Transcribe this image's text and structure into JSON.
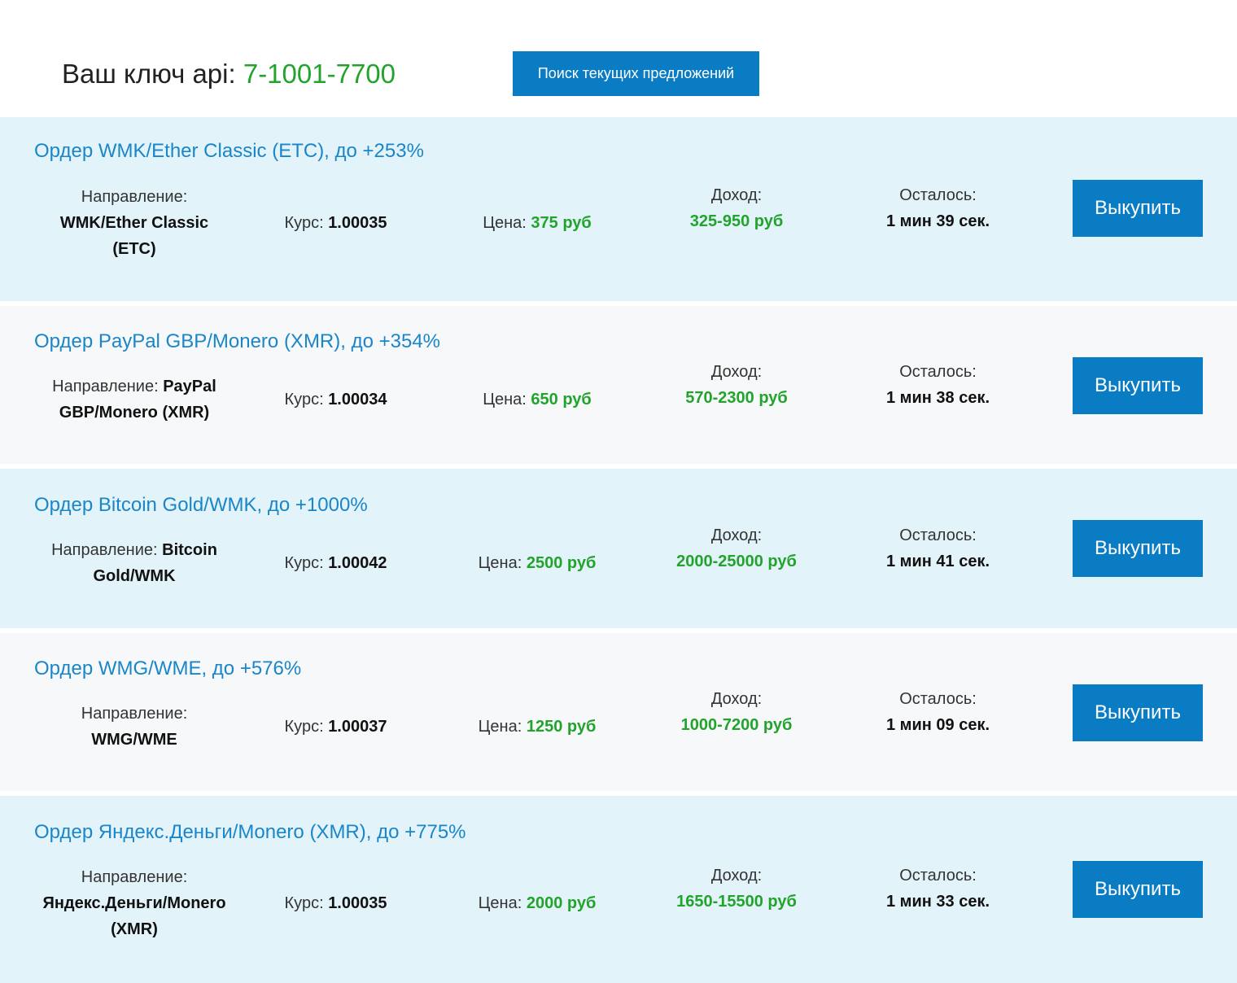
{
  "header": {
    "api_label": "Ваш ключ api:",
    "api_key": "7-1001-7700",
    "search_button": "Поиск текущих предложений"
  },
  "labels": {
    "direction": "Направление:",
    "rate": "Курс:",
    "price": "Цена:",
    "income": "Доход:",
    "remaining": "Осталось:",
    "buy": "Выкупить"
  },
  "orders": [
    {
      "title": "Ордер WMK/Ether Classic (ETC), до +253%",
      "direction_line1": "WMK/Ether Classic",
      "direction_line2": "(ETC)",
      "rate": "1.00035",
      "price": "375 руб",
      "income": "325-950 руб",
      "remaining": "1 мин 39 сек."
    },
    {
      "title": "Ордер PayPal GBP/Monero (XMR), до +354%",
      "direction_line1": "PayPal",
      "direction_line2": "GBP/Monero (XMR)",
      "rate": "1.00034",
      "price": "650 руб",
      "income": "570-2300 руб",
      "remaining": "1 мин 38 сек."
    },
    {
      "title": "Ордер Bitcoin Gold/WMK, до +1000%",
      "direction_line1": "Bitcoin",
      "direction_line2": "Gold/WMK",
      "rate": "1.00042",
      "price": "2500 руб",
      "income": "2000-25000 руб",
      "remaining": "1 мин 41 сек."
    },
    {
      "title": "Ордер WMG/WME, до +576%",
      "direction_line1": "WMG/WME",
      "direction_line2": "",
      "rate": "1.00037",
      "price": "1250 руб",
      "income": "1000-7200 руб",
      "remaining": "1 мин 09 сек."
    },
    {
      "title": "Ордер Яндекс.Деньги/Monero (XMR), до +775%",
      "direction_line1": "Яндекс.Деньги/Monero",
      "direction_line2": "(XMR)",
      "rate": "1.00035",
      "price": "2000 руб",
      "income": "1650-15500 руб",
      "remaining": "1 мин 33 сек."
    }
  ]
}
